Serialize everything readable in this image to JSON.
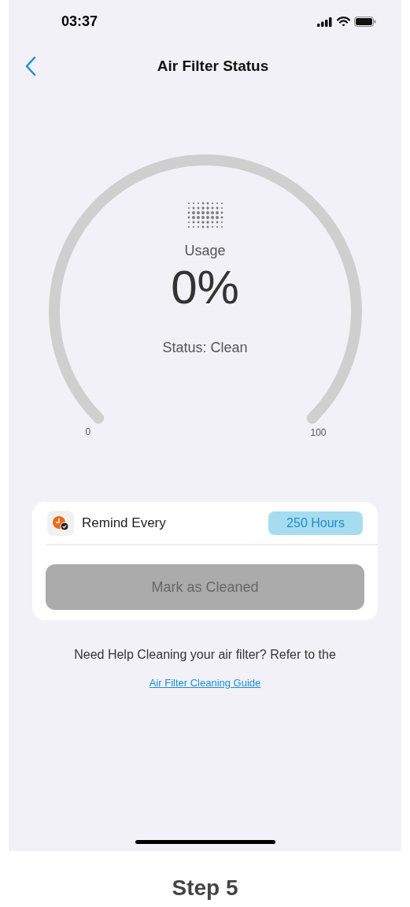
{
  "status_bar": {
    "time": "03:37"
  },
  "header": {
    "title": "Air Filter Status"
  },
  "gauge": {
    "label": "Usage",
    "value": "0%",
    "status": "Status: Clean",
    "min_label": "0",
    "max_label": "100"
  },
  "reminder": {
    "label": "Remind Every",
    "value": "250 Hours"
  },
  "mark_button": {
    "label": "Mark as Cleaned",
    "disabled": true
  },
  "help": {
    "text": "Need Help Cleaning your air filter? Refer to the",
    "link": "Air Filter Cleaning Guide"
  },
  "caption": "Step 5"
}
